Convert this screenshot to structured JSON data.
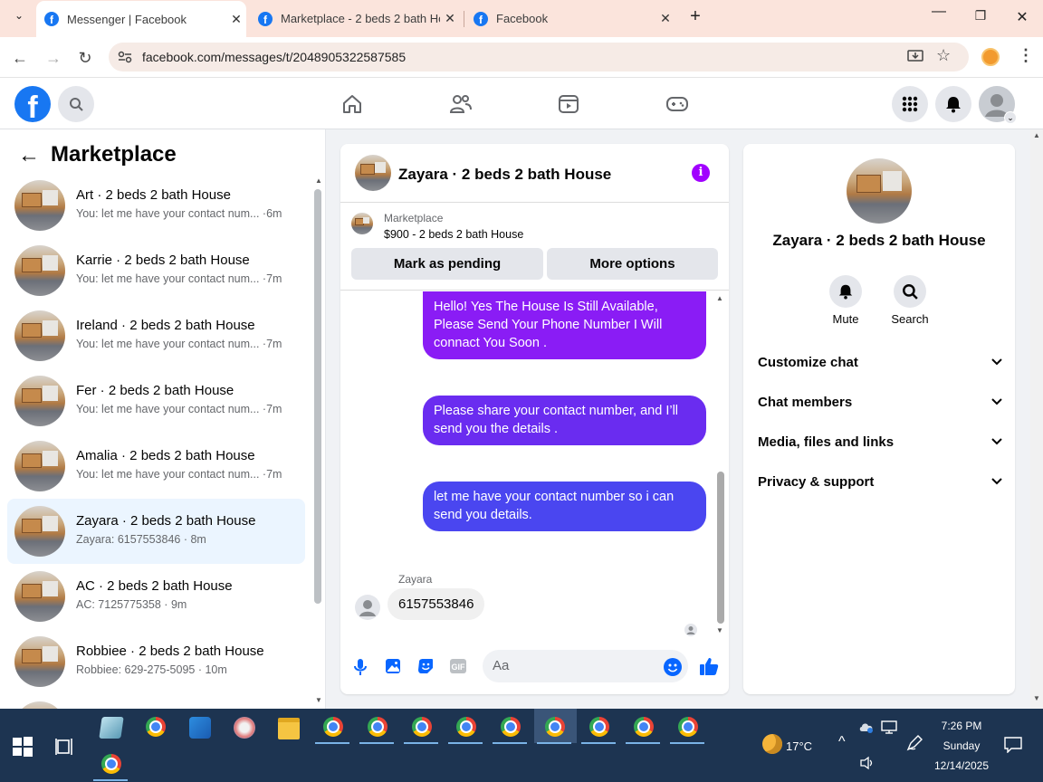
{
  "browser": {
    "tabs": [
      {
        "title": "Messenger | Facebook",
        "active": true
      },
      {
        "title": "Marketplace - 2 beds 2 bath Ho",
        "active": false
      },
      {
        "title": "Facebook",
        "active": false
      }
    ],
    "url": "facebook.com/messages/t/2048905322587585"
  },
  "left_panel": {
    "title": "Marketplace",
    "conversations": [
      {
        "name": "Art · 2 beds 2 bath House",
        "preview": "You: let me have your contact num... ·6m"
      },
      {
        "name": "Karrie · 2 beds 2 bath House",
        "preview": "You: let me have your contact num... ·7m"
      },
      {
        "name": "Ireland · 2 beds 2 bath House",
        "preview": "You: let me have your contact num... ·7m"
      },
      {
        "name": "Fer · 2 beds 2 bath House",
        "preview": "You: let me have your contact num... ·7m"
      },
      {
        "name": "Amalia · 2 beds 2 bath House",
        "preview": "You: let me have your contact num... ·7m"
      },
      {
        "name": "Zayara · 2 beds 2 bath House",
        "preview": "Zayara: 6157553846 · 8m",
        "active": true
      },
      {
        "name": "AC · 2 beds 2 bath House",
        "preview": "AC: 7125775358 · 9m"
      },
      {
        "name": "Robbiee · 2 beds 2 bath House",
        "preview": "Robbiee: 629-275-5095 · 10m"
      }
    ]
  },
  "chat": {
    "title": "Zayara · 2 beds 2 bath House",
    "listing_category": "Marketplace",
    "listing_price_title": "$900 - 2 beds 2 bath House",
    "mark_pending_label": "Mark as pending",
    "more_options_label": "More options",
    "messages": [
      {
        "text": "Hello! Yes The House  Is Still Available, Please Send Your Phone Number I Will connact You Soon .",
        "color": "#8a1cf5"
      },
      {
        "text": "Please share your contact number, and I’ll send you the details .",
        "color": "#6a2cf0"
      },
      {
        "text": "let me have your contact number so i can send you details.",
        "color": "#4a46f0"
      }
    ],
    "received_sender": "Zayara",
    "received_text": "6157553846",
    "input_placeholder": "Aa"
  },
  "right_panel": {
    "name": "Zayara · 2 beds 2 bath House",
    "mute_label": "Mute",
    "search_label": "Search",
    "sections": [
      "Customize chat",
      "Chat members",
      "Media, files and links",
      "Privacy & support"
    ]
  },
  "taskbar": {
    "weather": "17°C",
    "time": "7:26 PM",
    "day": "Sunday",
    "date": "12/14/2025"
  },
  "colors": {
    "fb_blue": "#1877f2",
    "accent_purple": "#a100ff"
  }
}
